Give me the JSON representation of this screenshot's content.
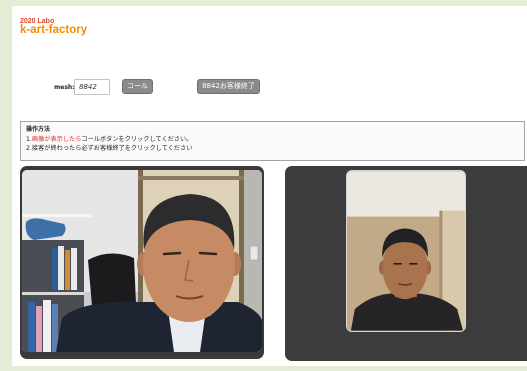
{
  "brand": {
    "subtitle": "2020 Labo",
    "name": "k-art-factory"
  },
  "controls": {
    "mesh_label": "mesh:",
    "mesh_value": "8842",
    "call_button": "コール",
    "end_button": "8842お客様終了"
  },
  "instructions": {
    "heading": "操作方法",
    "line1_prefix": "1.",
    "line1_highlight": "画像が表示したら",
    "line1_rest": "コールボタンをクリックしてください。",
    "line2": "2.接客が終わったら必ずお客様終了をクリックしてください"
  },
  "colors": {
    "brand_orange": "#f28c00",
    "brand_red": "#e8452c",
    "highlight_red": "#e02a2a",
    "button_gray": "#8b8b8b",
    "frame_green": "#e3ecd5",
    "video_panel": "#3a3a3a"
  }
}
